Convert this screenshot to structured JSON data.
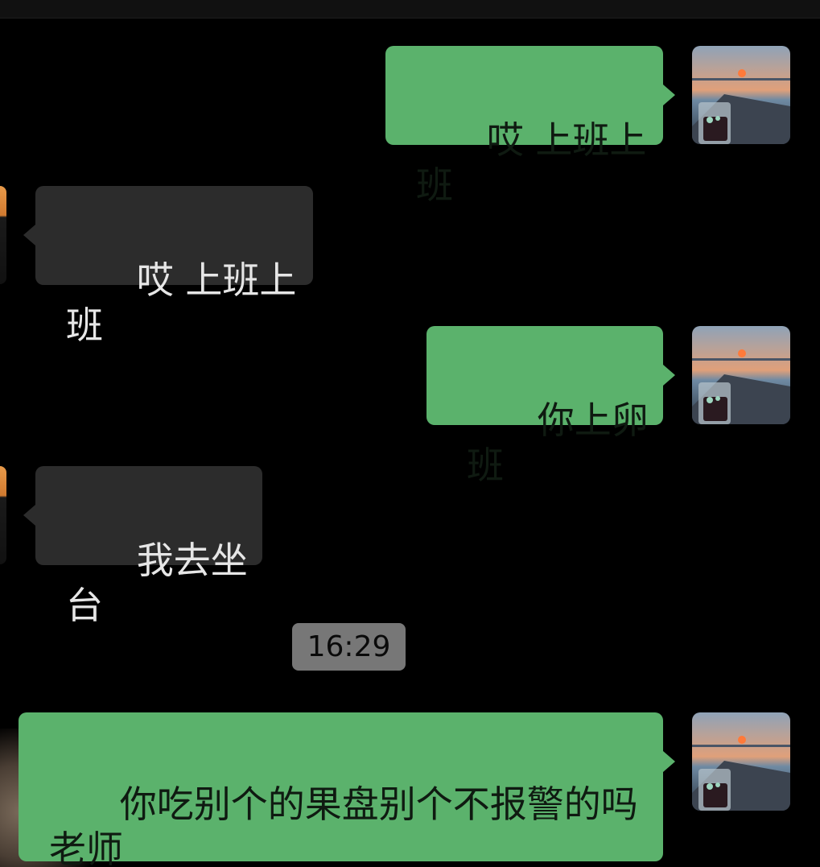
{
  "colors": {
    "background": "#000000",
    "outgoing_bubble": "#5bb26c",
    "incoming_bubble": "#2c2c2c",
    "timestamp_pill": "#777777"
  },
  "messages": [
    {
      "direction": "outgoing",
      "text": "哎 上班上班"
    },
    {
      "direction": "incoming",
      "text": "哎 上班上班"
    },
    {
      "direction": "outgoing",
      "text": "你上卵班"
    },
    {
      "direction": "incoming",
      "text": "我去坐台"
    },
    {
      "direction": "outgoing",
      "text": "你吃别个的果盘别个不报警的吗\n老师"
    }
  ],
  "timestamp": "16:29",
  "icons": {
    "own_avatar": "sunset-harbor-avatar",
    "peer_avatar": "peer-avatar"
  }
}
